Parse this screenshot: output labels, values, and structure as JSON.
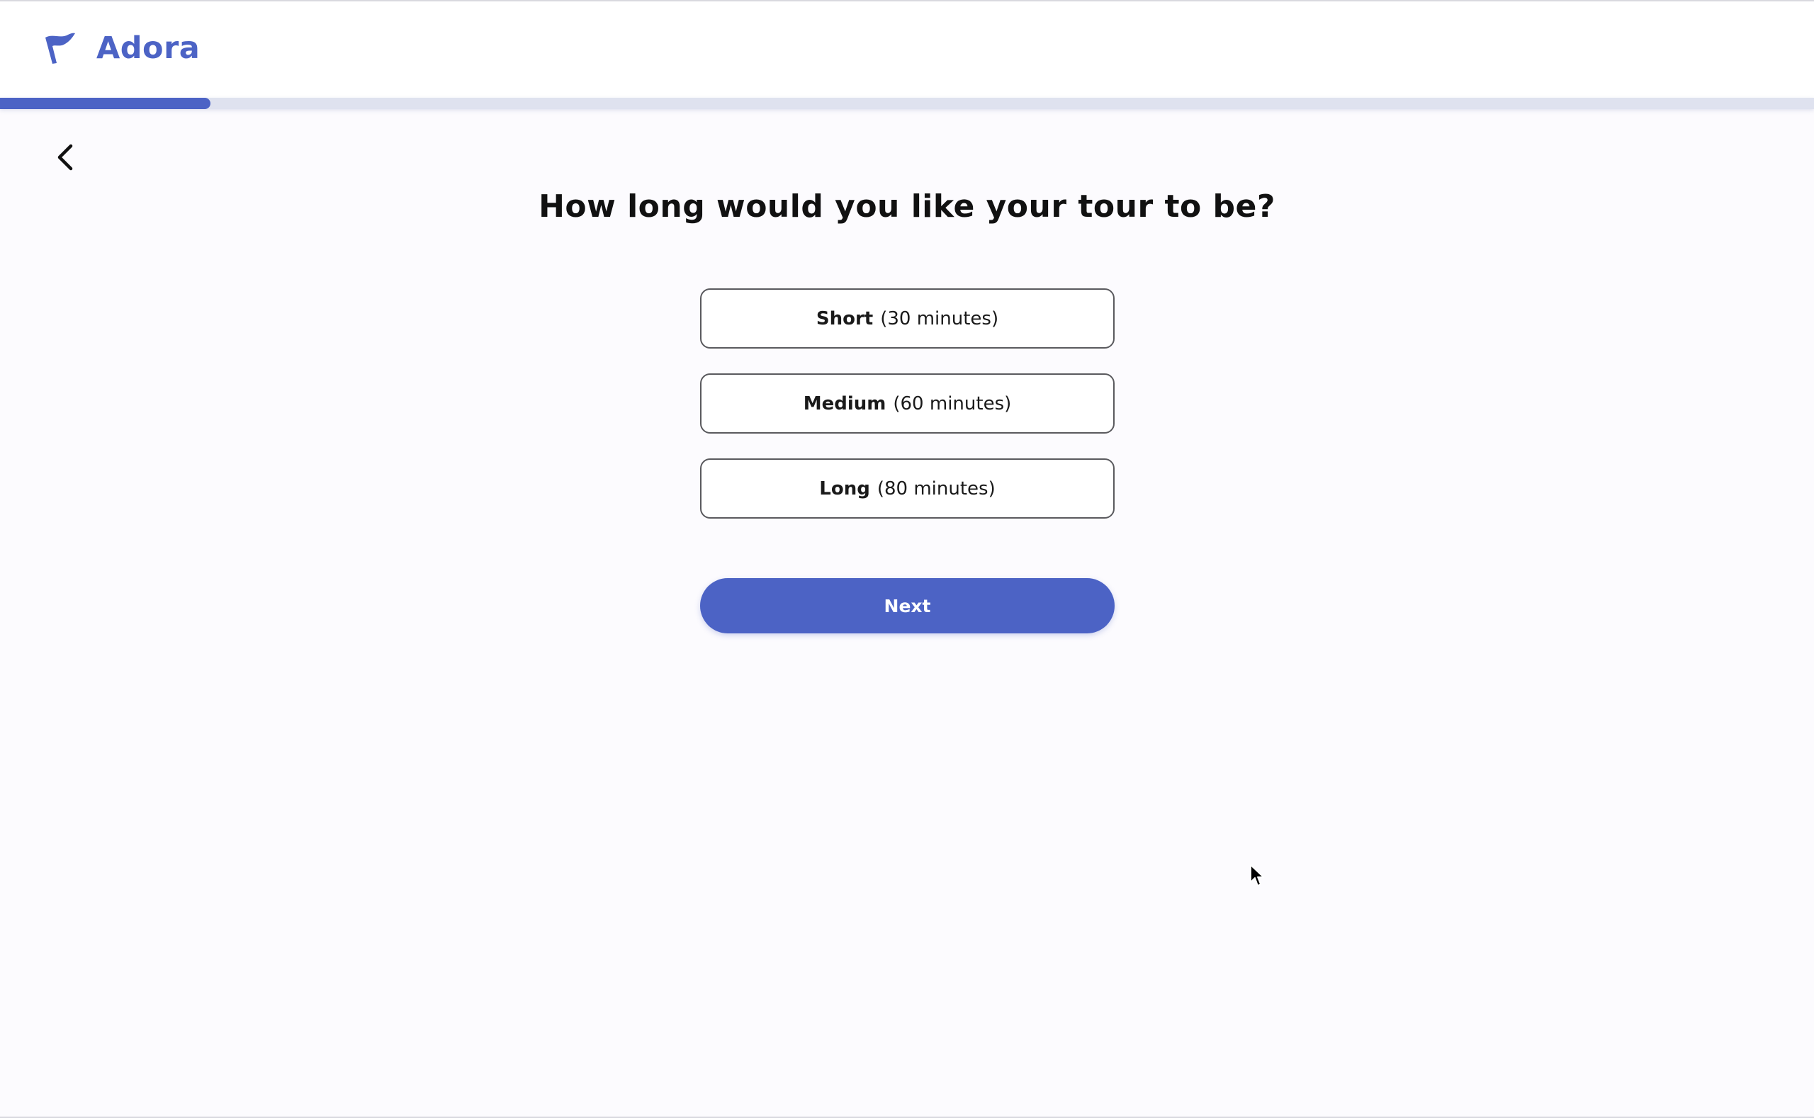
{
  "header": {
    "brand_name": "Adora",
    "logo_icon": "flag-icon",
    "accent_color": "#4c63c5"
  },
  "progress": {
    "fraction": 0.116
  },
  "navigation": {
    "back_icon": "chevron-left-icon"
  },
  "question": {
    "text": "How long would you like your tour to be?"
  },
  "options": [
    {
      "name": "Short",
      "detail": "(30 minutes)"
    },
    {
      "name": "Medium",
      "detail": "(60 minutes)"
    },
    {
      "name": "Long",
      "detail": "(80 minutes)"
    }
  ],
  "actions": {
    "next_label": "Next"
  }
}
